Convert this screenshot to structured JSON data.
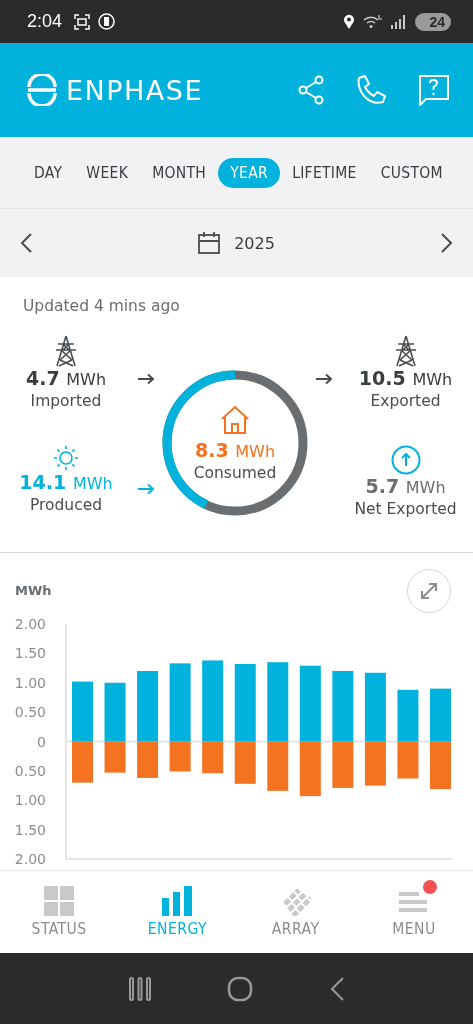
{
  "status_bar": {
    "time": "2:04",
    "battery": "24"
  },
  "header": {
    "brand": "ENPHASE"
  },
  "tabs": [
    {
      "label": "DAY",
      "selected": false
    },
    {
      "label": "WEEK",
      "selected": false
    },
    {
      "label": "MONTH",
      "selected": false
    },
    {
      "label": "YEAR",
      "selected": true
    },
    {
      "label": "LIFETIME",
      "selected": false
    },
    {
      "label": "CUSTOM",
      "selected": false
    }
  ],
  "date_picker": {
    "label": "2025"
  },
  "summary": {
    "updated": "Updated 4 mins ago",
    "imported": {
      "value": "4.7",
      "unit": "MWh",
      "label": "Imported"
    },
    "produced": {
      "value": "14.1",
      "unit": "MWh",
      "label": "Produced"
    },
    "consumed": {
      "value": "8.3",
      "unit": "MWh",
      "label": "Consumed"
    },
    "exported": {
      "value": "10.5",
      "unit": "MWh",
      "label": "Exported"
    },
    "net_exported": {
      "value": "5.7",
      "unit": "MWh",
      "label": "Net Exported"
    }
  },
  "chart": {
    "chart_data": {
      "type": "bar",
      "ylabel": "MWh",
      "stacked": true,
      "ylim": [
        -2,
        2
      ],
      "yticks": [
        {
          "value": 2,
          "label": "2.00"
        },
        {
          "value": 1.5,
          "label": "1.50"
        },
        {
          "value": 1,
          "label": "1.00"
        },
        {
          "value": 0.5,
          "label": "0.50"
        },
        {
          "value": 0,
          "label": "0"
        },
        {
          "value": -0.5,
          "label": "0.50"
        },
        {
          "value": -1,
          "label": "1.00"
        },
        {
          "value": -1.5,
          "label": "1.50"
        },
        {
          "value": -2,
          "label": "2.00"
        }
      ],
      "series": [
        {
          "color": "#00b2dc",
          "values": [
            1.02,
            1.0,
            1.2,
            1.33,
            1.38,
            1.32,
            1.35,
            1.29,
            1.2,
            1.17,
            0.88,
            0.9
          ]
        },
        {
          "color": "#f37321",
          "values": [
            -0.7,
            -0.53,
            -0.62,
            -0.51,
            -0.54,
            -0.72,
            -0.84,
            -0.93,
            -0.79,
            -0.75,
            -0.63,
            -0.81
          ]
        }
      ]
    }
  },
  "bottom_nav": [
    {
      "label": "STATUS",
      "selected": false,
      "kind": "status",
      "notification": false
    },
    {
      "label": "ENERGY",
      "selected": true,
      "kind": "energy",
      "notification": false
    },
    {
      "label": "ARRAY",
      "selected": false,
      "kind": "array",
      "notification": false
    },
    {
      "label": "MENU",
      "selected": false,
      "kind": "menu",
      "notification": true
    }
  ]
}
